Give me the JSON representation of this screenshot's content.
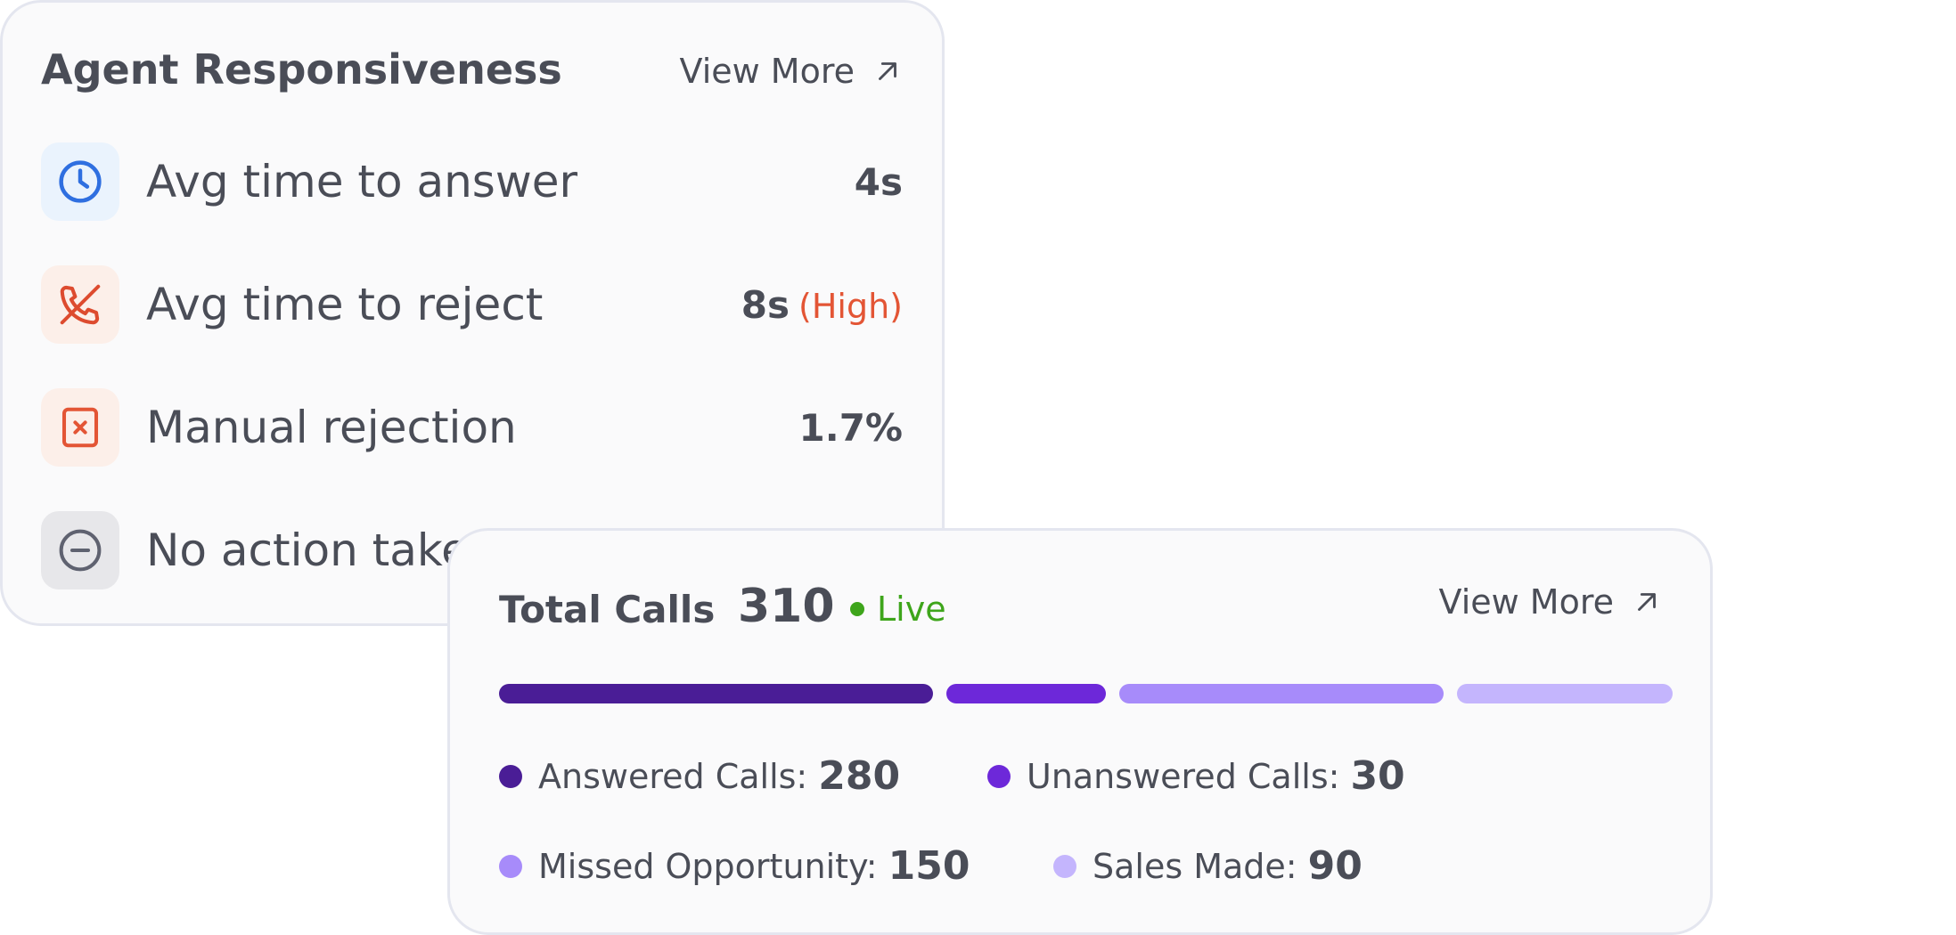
{
  "agent_responsiveness": {
    "title": "Agent Responsiveness",
    "view_more": "View More",
    "metrics": [
      {
        "label": "Avg time to answer",
        "value": "4s",
        "icon": "clock-icon",
        "icon_color": "#2f6fe0",
        "icon_bg": "#eaf3fd"
      },
      {
        "label": "Avg time to reject",
        "value": "8s",
        "note": "(High)",
        "icon": "phone-missed-icon",
        "icon_color": "#dd4b2f",
        "icon_bg": "#fcefe9"
      },
      {
        "label": "Manual rejection",
        "value": "1.7%",
        "icon": "x-square-icon",
        "icon_color": "#e35535",
        "icon_bg": "#fcefe9"
      },
      {
        "label": "No action taken",
        "value": "",
        "icon": "minus-circle-icon",
        "icon_color": "#5f6270",
        "icon_bg": "#e7e7ea"
      }
    ]
  },
  "total_calls": {
    "title": "Total Calls",
    "value": "310",
    "status": "Live",
    "view_more": "View More",
    "status_color": "#3ea51b",
    "segments": [
      {
        "label": "Answered Calls:",
        "value": "280",
        "color": "#4a1d96"
      },
      {
        "label": "Unanswered Calls:",
        "value": "30",
        "color": "#6d28d9"
      },
      {
        "label": "Missed Opportunity:",
        "value": "150",
        "color": "#a78bfa"
      },
      {
        "label": "Sales Made:",
        "value": "90",
        "color": "#c4b5fd"
      }
    ]
  }
}
